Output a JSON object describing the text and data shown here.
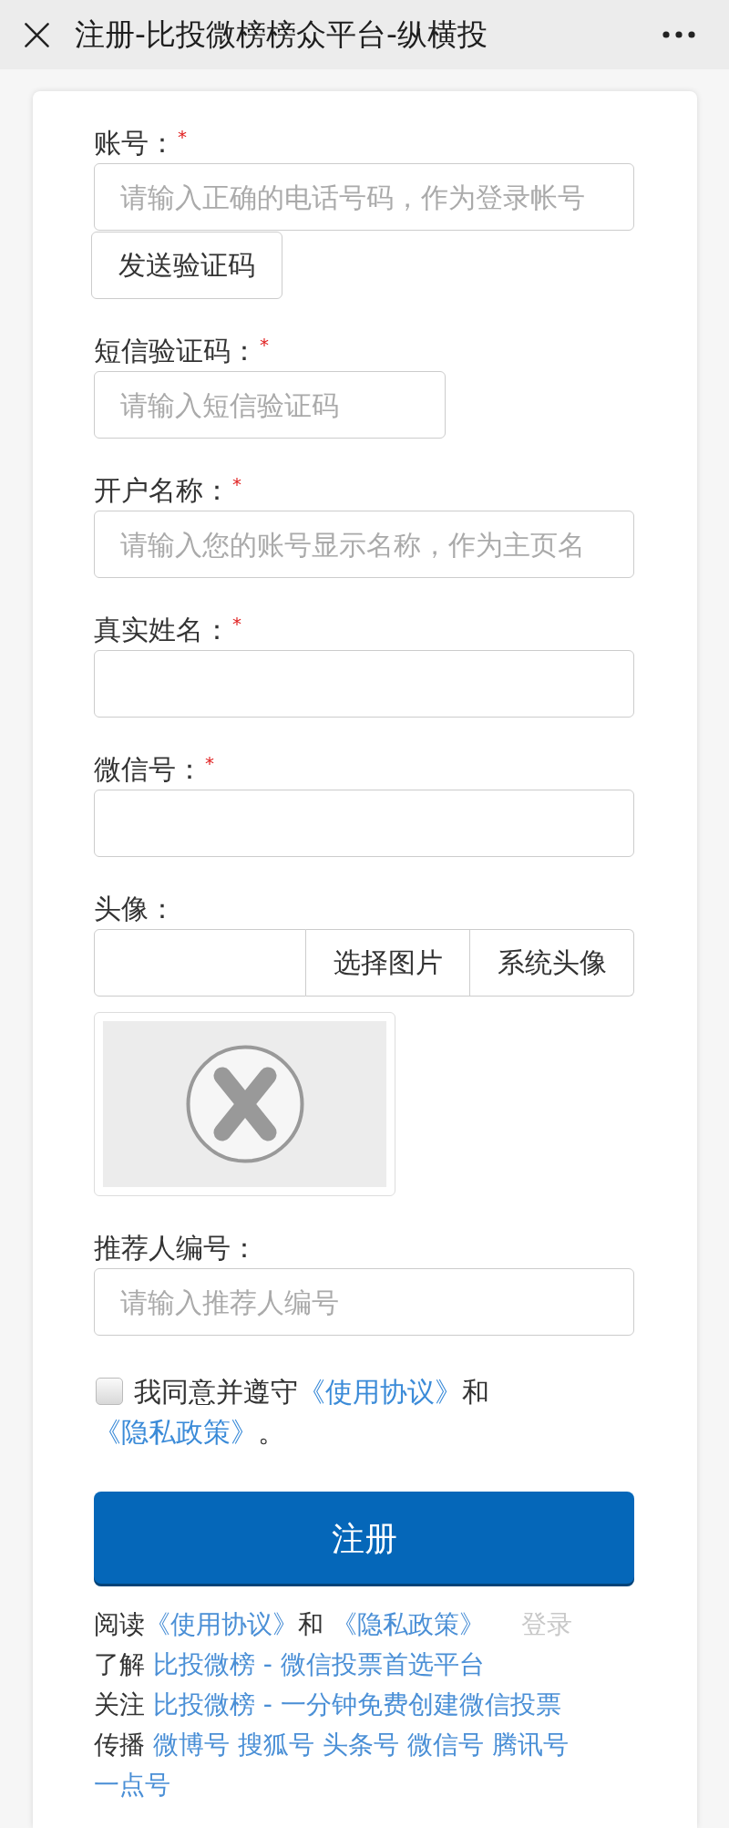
{
  "header": {
    "title": "注册-比投微榜榜众平台-纵横投"
  },
  "form": {
    "fields": [
      {
        "kind": "text",
        "label": "账号：",
        "required_mark": "*",
        "placeholder": "请输入正确的电话号码，作为登录帐号",
        "button": "发送验证码"
      },
      {
        "kind": "code",
        "label": "短信验证码：",
        "required_mark": "*",
        "placeholder": "请输入短信验证码"
      },
      {
        "kind": "text",
        "label": "开户名称：",
        "required_mark": "*",
        "placeholder": "请输入您的账号显示名称，作为主页名"
      },
      {
        "kind": "text",
        "label": "真实姓名：",
        "required_mark": "*"
      },
      {
        "kind": "text",
        "label": "微信号：",
        "required_mark": "*"
      },
      {
        "kind": "image",
        "label": "头像：",
        "buttons": [
          "选择图片",
          "系统头像"
        ]
      },
      {
        "kind": "text",
        "label": "推荐人编号：",
        "placeholder": "请输入推荐人编号"
      }
    ]
  },
  "agreement": {
    "checked": false,
    "parts": [
      {
        "kind": "text",
        "text": "我同意并遵守"
      },
      {
        "kind": "link",
        "text": "《使用协议》"
      },
      {
        "kind": "text",
        "text": "和 "
      },
      {
        "kind": "link",
        "text": "《隐私政策》"
      },
      {
        "kind": "text",
        "text": "。"
      }
    ]
  },
  "register_button": "注册",
  "footer": {
    "read_parts": [
      {
        "kind": "text",
        "text": "阅读"
      },
      {
        "kind": "link",
        "text": "《使用协议》"
      },
      {
        "kind": "text",
        "text": "和 "
      },
      {
        "kind": "link",
        "text": "《隐私政策》"
      }
    ],
    "login": "登录",
    "lines": [
      {
        "label": "了解",
        "links": [
          "比投微榜 - 微信投票首选平台"
        ]
      },
      {
        "label": "关注",
        "links": [
          "比投微榜 - 一分钟免费创建微信投票"
        ]
      },
      {
        "label": "传播",
        "links": [
          "微博号",
          "搜狐号",
          "头条号",
          "微信号",
          "腾讯号",
          "一点号"
        ]
      }
    ]
  }
}
